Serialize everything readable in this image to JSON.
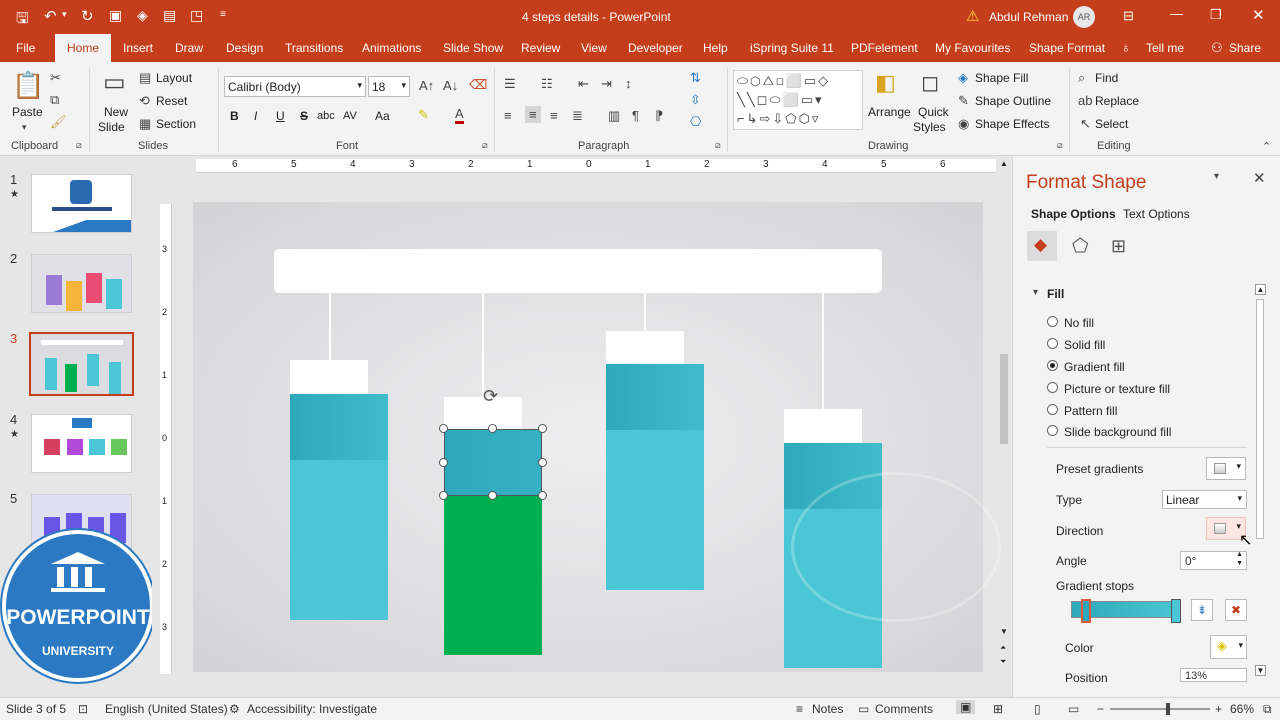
{
  "title_bar": {
    "doc_title": "4 steps details  -  PowerPoint",
    "user_name": "Abdul Rehman",
    "user_initials": "AR"
  },
  "tabs": [
    "File",
    "Home",
    "Insert",
    "Draw",
    "Design",
    "Transitions",
    "Animations",
    "Slide Show",
    "Review",
    "View",
    "Developer",
    "Help",
    "iSpring Suite 11",
    "PDFelement",
    "My Favourites",
    "Shape Format",
    "Tell me",
    "Share"
  ],
  "ribbon": {
    "clipboard": {
      "paste": "Paste",
      "group": "Clipboard"
    },
    "slides": {
      "new_slide_1": "New",
      "new_slide_2": "Slide",
      "layout": "Layout",
      "reset": "Reset",
      "section": "Section",
      "group": "Slides"
    },
    "font": {
      "font_name": "Calibri (Body)",
      "font_size": "18",
      "bold": "B",
      "italic": "I",
      "underline": "U",
      "strike": "S",
      "shadow": "abc",
      "spacing": "AV",
      "case": "Aa",
      "group": "Font"
    },
    "paragraph": {
      "group": "Paragraph"
    },
    "drawing": {
      "arrange": "Arrange",
      "quick_styles_1": "Quick",
      "quick_styles_2": "Styles",
      "shape_fill": "Shape Fill",
      "shape_outline": "Shape Outline",
      "shape_effects": "Shape Effects",
      "group": "Drawing"
    },
    "editing": {
      "find": "Find",
      "replace": "Replace",
      "select": "Select",
      "group": "Editing"
    }
  },
  "thumbnails": [
    {
      "num": "1",
      "star": "★"
    },
    {
      "num": "2",
      "star": ""
    },
    {
      "num": "3",
      "star": ""
    },
    {
      "num": "4",
      "star": "★"
    },
    {
      "num": "5",
      "star": ""
    }
  ],
  "ruler": {
    "h_labels": [
      "6",
      "5",
      "4",
      "3",
      "2",
      "1",
      "0",
      "1",
      "2",
      "3",
      "4",
      "5",
      "6"
    ],
    "v_labels": [
      "3",
      "2",
      "1",
      "0",
      "1",
      "2",
      "3"
    ]
  },
  "watermark": {
    "line1": "POWERPOINT",
    "line2": "UNIVERSITY"
  },
  "format_pane": {
    "title": "Format Shape",
    "tab_shape": "Shape Options",
    "tab_text": "Text Options",
    "section": "Fill",
    "options": [
      "No fill",
      "Solid fill",
      "Gradient fill",
      "Picture or texture fill",
      "Pattern fill",
      "Slide background fill"
    ],
    "selected_option": "Gradient fill",
    "preset_label": "Preset gradients",
    "type_label": "Type",
    "type_value": "Linear",
    "direction_label": "Direction",
    "angle_label": "Angle",
    "angle_value": "0°",
    "stops_label": "Gradient stops",
    "color_label": "Color",
    "position_label": "Position",
    "position_value": "13%"
  },
  "status": {
    "slide_info": "Slide 3 of 5",
    "language": "English (United States)",
    "accessibility": "Accessibility: Investigate",
    "notes": "Notes",
    "comments": "Comments",
    "zoom": "66%"
  },
  "colors": {
    "accent": "#c43e1c",
    "teal": "#4ac6d6",
    "teal_dark": "#2ea9bb",
    "green": "#00b050"
  }
}
